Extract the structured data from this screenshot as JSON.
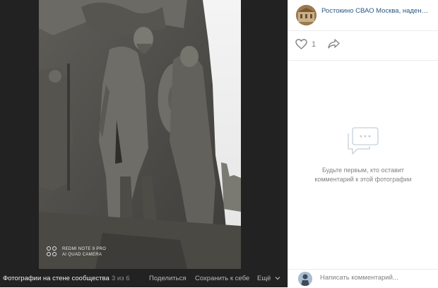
{
  "post": {
    "author": "Ростокино СВАО Москва, надень ..."
  },
  "likes": {
    "count": "1",
    "icon": "heart-icon"
  },
  "empty_comments": {
    "text_line1": "Будьте первым, кто оставит",
    "text_line2": "комментарий к этой фотографии"
  },
  "comment_box": {
    "placeholder": "Написать комментарий..."
  },
  "viewer": {
    "album_title": "Фотографии на стене сообщества",
    "counter": "3 из 6",
    "share_label": "Поделиться",
    "save_label": "Сохранить к себе",
    "more_label": "Ещё"
  },
  "watermark": {
    "line1": "REDMI NOTE 9 PRO",
    "line2": "AI QUAD CAMERA"
  },
  "colors": {
    "link": "#2a5885",
    "viewer_bg": "#222222",
    "muted": "#828282"
  }
}
